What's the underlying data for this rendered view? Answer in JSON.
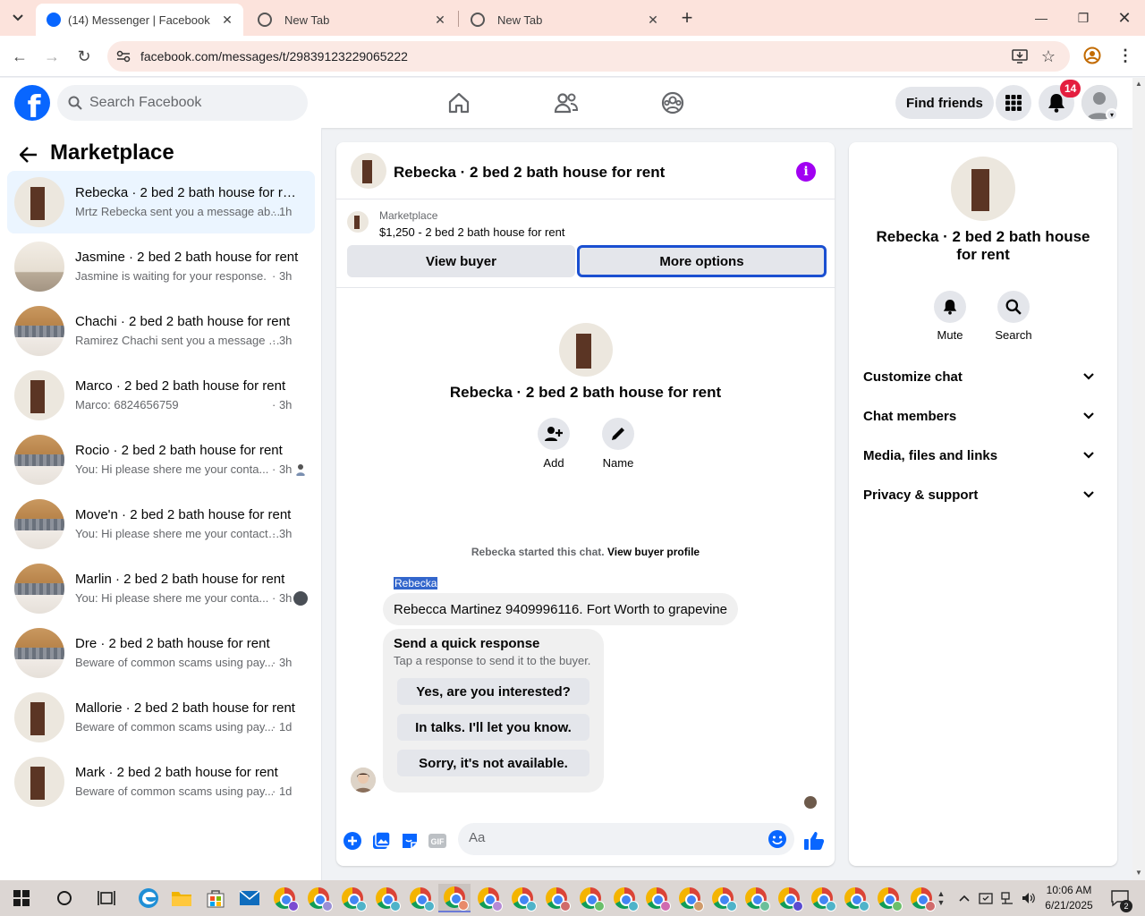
{
  "browser": {
    "tabs": [
      {
        "title": "(14) Messenger | Facebook",
        "active": true
      },
      {
        "title": "New Tab",
        "active": false
      },
      {
        "title": "New Tab",
        "active": false
      }
    ],
    "url": "facebook.com/messages/t/29839123229065222"
  },
  "header": {
    "search_placeholder": "Search Facebook",
    "find_friends_label": "Find friends",
    "notification_count": "14"
  },
  "sidebar": {
    "title": "Marketplace",
    "conversations": [
      {
        "name": "Rebecka · 2 bed 2 bath house for rent",
        "preview": "Mrtz Rebecka sent you a message ab...",
        "time": "· 1h"
      },
      {
        "name": "Jasmine · 2 bed 2 bath house for rent",
        "preview": "Jasmine is waiting for your response.",
        "time": "· 3h"
      },
      {
        "name": "Chachi · 2 bed 2 bath house for rent",
        "preview": "Ramirez Chachi sent you a message a...",
        "time": "· 3h"
      },
      {
        "name": "Marco · 2 bed 2 bath house for rent",
        "preview": "Marco: 6824656759",
        "time": "· 3h"
      },
      {
        "name": "Rocio · 2 bed 2 bath house for rent",
        "preview": "You: Hi please shere me your conta...",
        "time": "· 3h"
      },
      {
        "name": "Move'n · 2 bed 2 bath house for rent",
        "preview": "You: Hi please shere me your contact ...",
        "time": "· 3h"
      },
      {
        "name": "Marlin · 2 bed 2 bath house for rent",
        "preview": "You: Hi please shere me your conta...",
        "time": "· 3h"
      },
      {
        "name": "Dre · 2 bed 2 bath house for rent",
        "preview": "Beware of common scams using pay...",
        "time": "· 3h"
      },
      {
        "name": "Mallorie · 2 bed 2 bath house for rent",
        "preview": "Beware of common scams using pay...",
        "time": "· 1d"
      },
      {
        "name": "Mark · 2 bed 2 bath house for rent",
        "preview": "Beware of common scams using pay...",
        "time": "· 1d"
      }
    ]
  },
  "chat": {
    "title": "Rebecka · 2 bed 2 bath house for rent",
    "listing_source": "Marketplace",
    "listing_price": "$1,250 - 2 bed 2 bath house for rent",
    "view_buyer_label": "View buyer",
    "more_options_label": "More options",
    "profile_name": "Rebecka · 2 bed 2 bath house for rent",
    "add_label": "Add",
    "name_label": "Name",
    "started_text": "Rebecka started this chat.",
    "view_buyer_profile": "View buyer profile",
    "sender": "Rebecka",
    "message": "Rebecca Martinez 9409996116. Fort Worth to grapevine",
    "quick_title": "Send a quick response",
    "quick_subtitle": "Tap a response to send it to the buyer.",
    "quick_responses": [
      "Yes, are you interested?",
      "In talks. I'll let you know.",
      "Sorry, it's not available."
    ],
    "composer_placeholder": "Aa"
  },
  "info_panel": {
    "name": "Rebecka · 2 bed 2 bath house for rent",
    "mute_label": "Mute",
    "search_label": "Search",
    "sections": [
      "Customize chat",
      "Chat members",
      "Media, files and links",
      "Privacy & support"
    ]
  },
  "taskbar": {
    "time": "10:06 AM",
    "date": "6/21/2025",
    "notification_count": "2"
  },
  "colors": {
    "fb_blue": "#0866ff",
    "info_purple": "#a100f2",
    "badge_red": "#e41e3f",
    "active_row": "#ebf5ff"
  },
  "icons": [
    "facebook-logo",
    "search-icon",
    "home-icon",
    "friends-icon",
    "groups-icon",
    "menu-grid-icon",
    "bell-icon",
    "info-icon",
    "add-person-icon",
    "pencil-icon",
    "mute-icon",
    "chevron-down-icon",
    "plus-icon",
    "image-icon",
    "sticker-icon",
    "gif-icon",
    "emoji-icon",
    "like-icon"
  ]
}
